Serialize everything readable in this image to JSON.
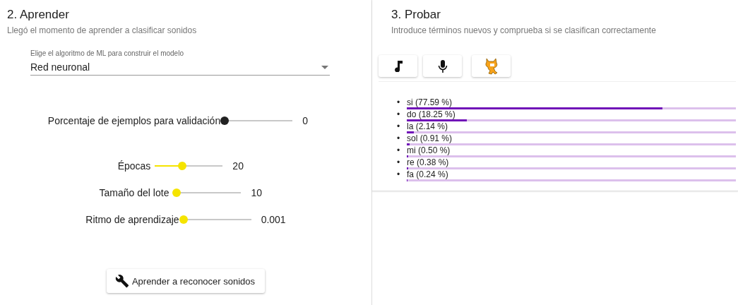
{
  "learn": {
    "title": "2. Aprender",
    "subtitle": "Llegó el momento de aprender a clasificar sonidos",
    "algorithm": {
      "label": "Elige el algoritmo de ML para construir el modelo",
      "value": "Red neuronal"
    },
    "sliders": [
      {
        "label": "Porcentaje de ejemplos para validación",
        "level": 0,
        "reading": "0",
        "color": "#222222"
      },
      {
        "label": "Épocas",
        "level": 0.4,
        "reading": "20",
        "color": "#f5e400"
      },
      {
        "label": "Tamaño del lote",
        "level": 0.05,
        "reading": "10",
        "color": "#f5e400"
      },
      {
        "label": "Ritmo de aprendizaje",
        "level": 0,
        "reading": "0.001",
        "color": "#f5e400"
      }
    ],
    "button": "Aprender a reconocer sonidos"
  },
  "test": {
    "title": "3. Probar",
    "subtitle": "Introduce términos nuevos y comprueba si se clasifican correctamente",
    "sources": [
      {
        "kind": "music"
      },
      {
        "kind": "microphone"
      },
      {
        "kind": "cat"
      }
    ],
    "results": [
      {
        "marker": "•",
        "label": "si (77.59 %)",
        "level": 0.7759
      },
      {
        "marker": "•",
        "label": "do (18.25 %)",
        "level": 0.1825
      },
      {
        "marker": "•",
        "label": "la (2.14 %)",
        "level": 0.0214
      },
      {
        "marker": "•",
        "label": "sol (0.91 %)",
        "level": 0.0091
      },
      {
        "marker": "•",
        "label": "mi (0.50 %)",
        "level": 0.005
      },
      {
        "marker": "•",
        "label": "re (0.38 %)",
        "level": 0.0038
      },
      {
        "marker": "•",
        "label": "fa (0.24 %)",
        "level": 0.0024
      }
    ]
  }
}
